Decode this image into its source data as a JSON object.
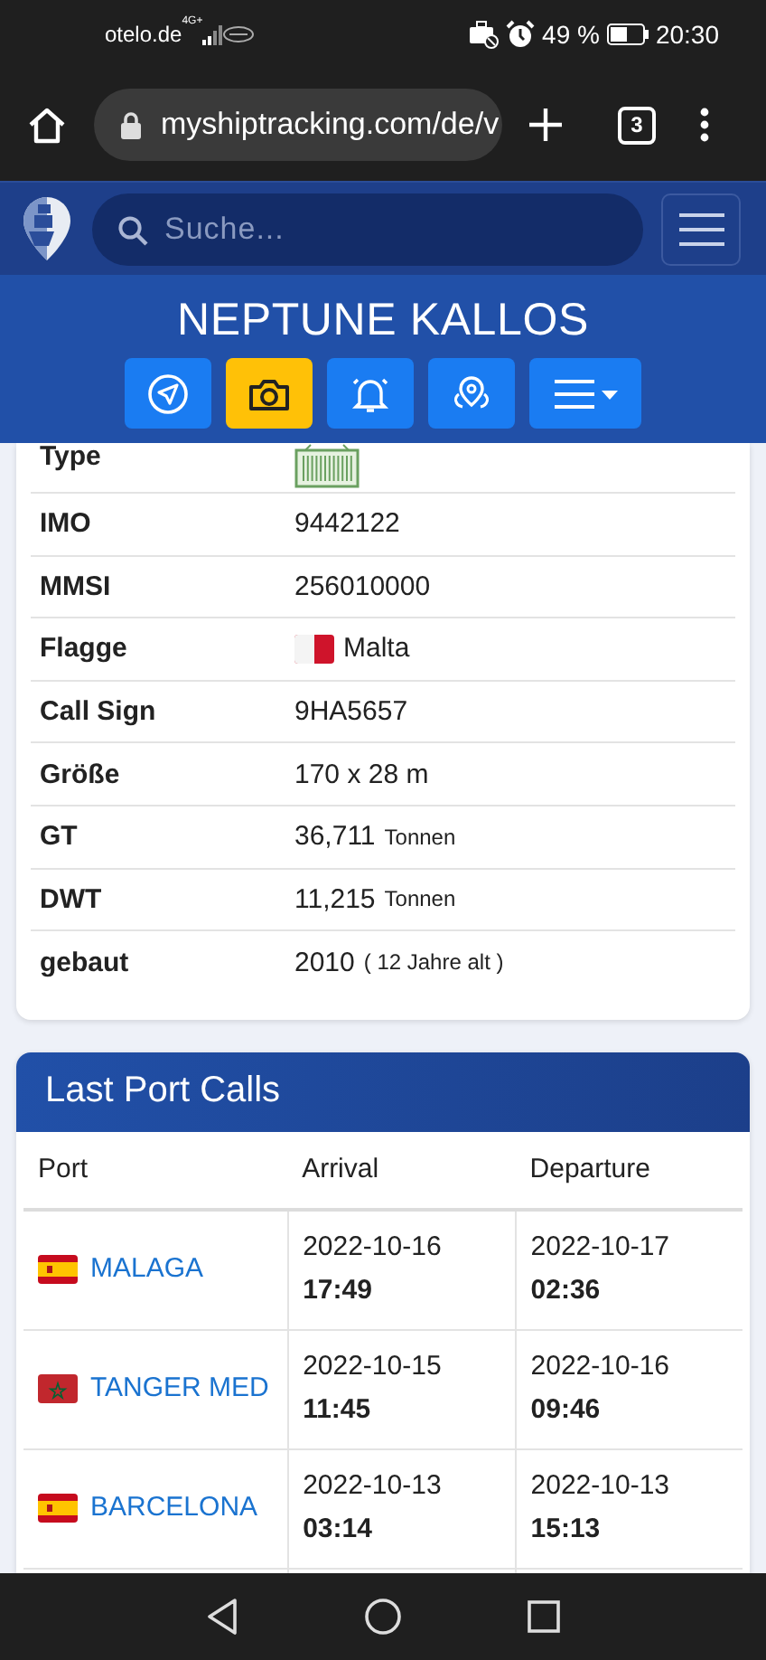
{
  "status_bar": {
    "carrier": "otelo.de",
    "network": "4G+",
    "battery": "49 %",
    "time": "20:30"
  },
  "browser": {
    "url": "myshiptracking.com/de/v",
    "tab_count": "3"
  },
  "site_header": {
    "search": {
      "placeholder": "Suche..."
    }
  },
  "vessel": {
    "name": "NEPTUNE KALLOS",
    "actions": [
      {
        "kind": "navigate",
        "selected": false
      },
      {
        "kind": "camera",
        "selected": true
      },
      {
        "kind": "alarm",
        "selected": false
      },
      {
        "kind": "locate",
        "selected": false
      },
      {
        "kind": "menu",
        "selected": false
      }
    ]
  },
  "details": [
    {
      "label": "Type",
      "kind": "container"
    },
    {
      "label": "IMO",
      "value": "9442122"
    },
    {
      "label": "MMSI",
      "value": "256010000"
    },
    {
      "label": "Flagge",
      "value": "Malta",
      "kind": "mt"
    },
    {
      "label": "Call Sign",
      "value": "9HA5657"
    },
    {
      "label": "Größe",
      "value": "170 x 28 m"
    },
    {
      "label": "GT",
      "value": "36,711",
      "unit": "Tonnen"
    },
    {
      "label": "DWT",
      "value": "11,215",
      "unit": "Tonnen"
    },
    {
      "label": "gebaut",
      "value": "2010",
      "unit": "( 12 Jahre alt )"
    }
  ],
  "port_calls": {
    "title": "Last Port Calls",
    "columns": [
      "Port",
      "Arrival",
      "Departure"
    ],
    "rows": [
      {
        "port": "MALAGA",
        "kind": "es",
        "arrival_date": "2022-10-16",
        "arrival_time": "17:49",
        "departure_date": "2022-10-17",
        "departure_time": "02:36"
      },
      {
        "port": "TANGER MED",
        "kind": "ma",
        "arrival_date": "2022-10-15",
        "arrival_time": "11:45",
        "departure_date": "2022-10-16",
        "departure_time": "09:46"
      },
      {
        "port": "BARCELONA",
        "kind": "es",
        "arrival_date": "2022-10-13",
        "arrival_time": "03:14",
        "departure_date": "2022-10-13",
        "departure_time": "15:13"
      }
    ]
  }
}
